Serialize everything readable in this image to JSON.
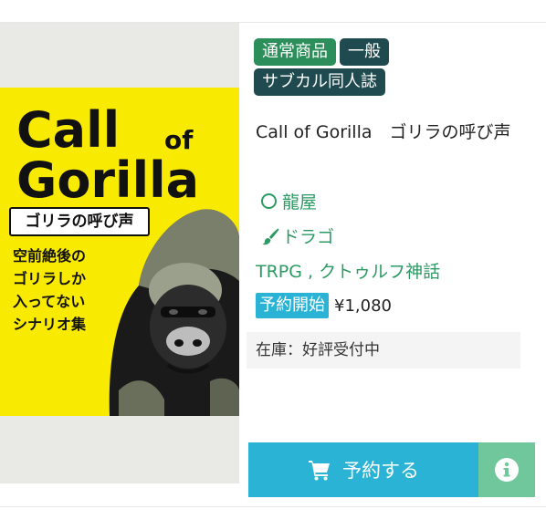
{
  "product": {
    "tags": [
      "通常商品",
      "一般",
      "サブカル同人誌"
    ],
    "title": "Call of Gorilla　ゴリラの呼び声",
    "circle": "龍屋",
    "author": "ドラゴ",
    "genres": "TRPG , クトゥルフ神話",
    "status": "予約開始",
    "price": "¥1,080",
    "stock": "在庫：好評受付中",
    "reserve_label": "予約する"
  },
  "cover": {
    "line1": "Call",
    "of": "of",
    "line2": "Gorilla",
    "subtitle": "ゴリラの呼び声",
    "blurb": [
      "空前絶後の",
      "ゴリラしか",
      "入ってない",
      "シナリオ集"
    ]
  },
  "icons": {
    "cart": "cart-icon",
    "info": "info-icon",
    "circle": "circle-icon",
    "brush": "brush-icon"
  },
  "colors": {
    "tag_green": "#2c8f5b",
    "tag_dark": "#1f4a4f",
    "link": "#2c9a63",
    "accent": "#2bb3d6",
    "info": "#6fc79b",
    "cover_yellow": "#f8ea00"
  }
}
